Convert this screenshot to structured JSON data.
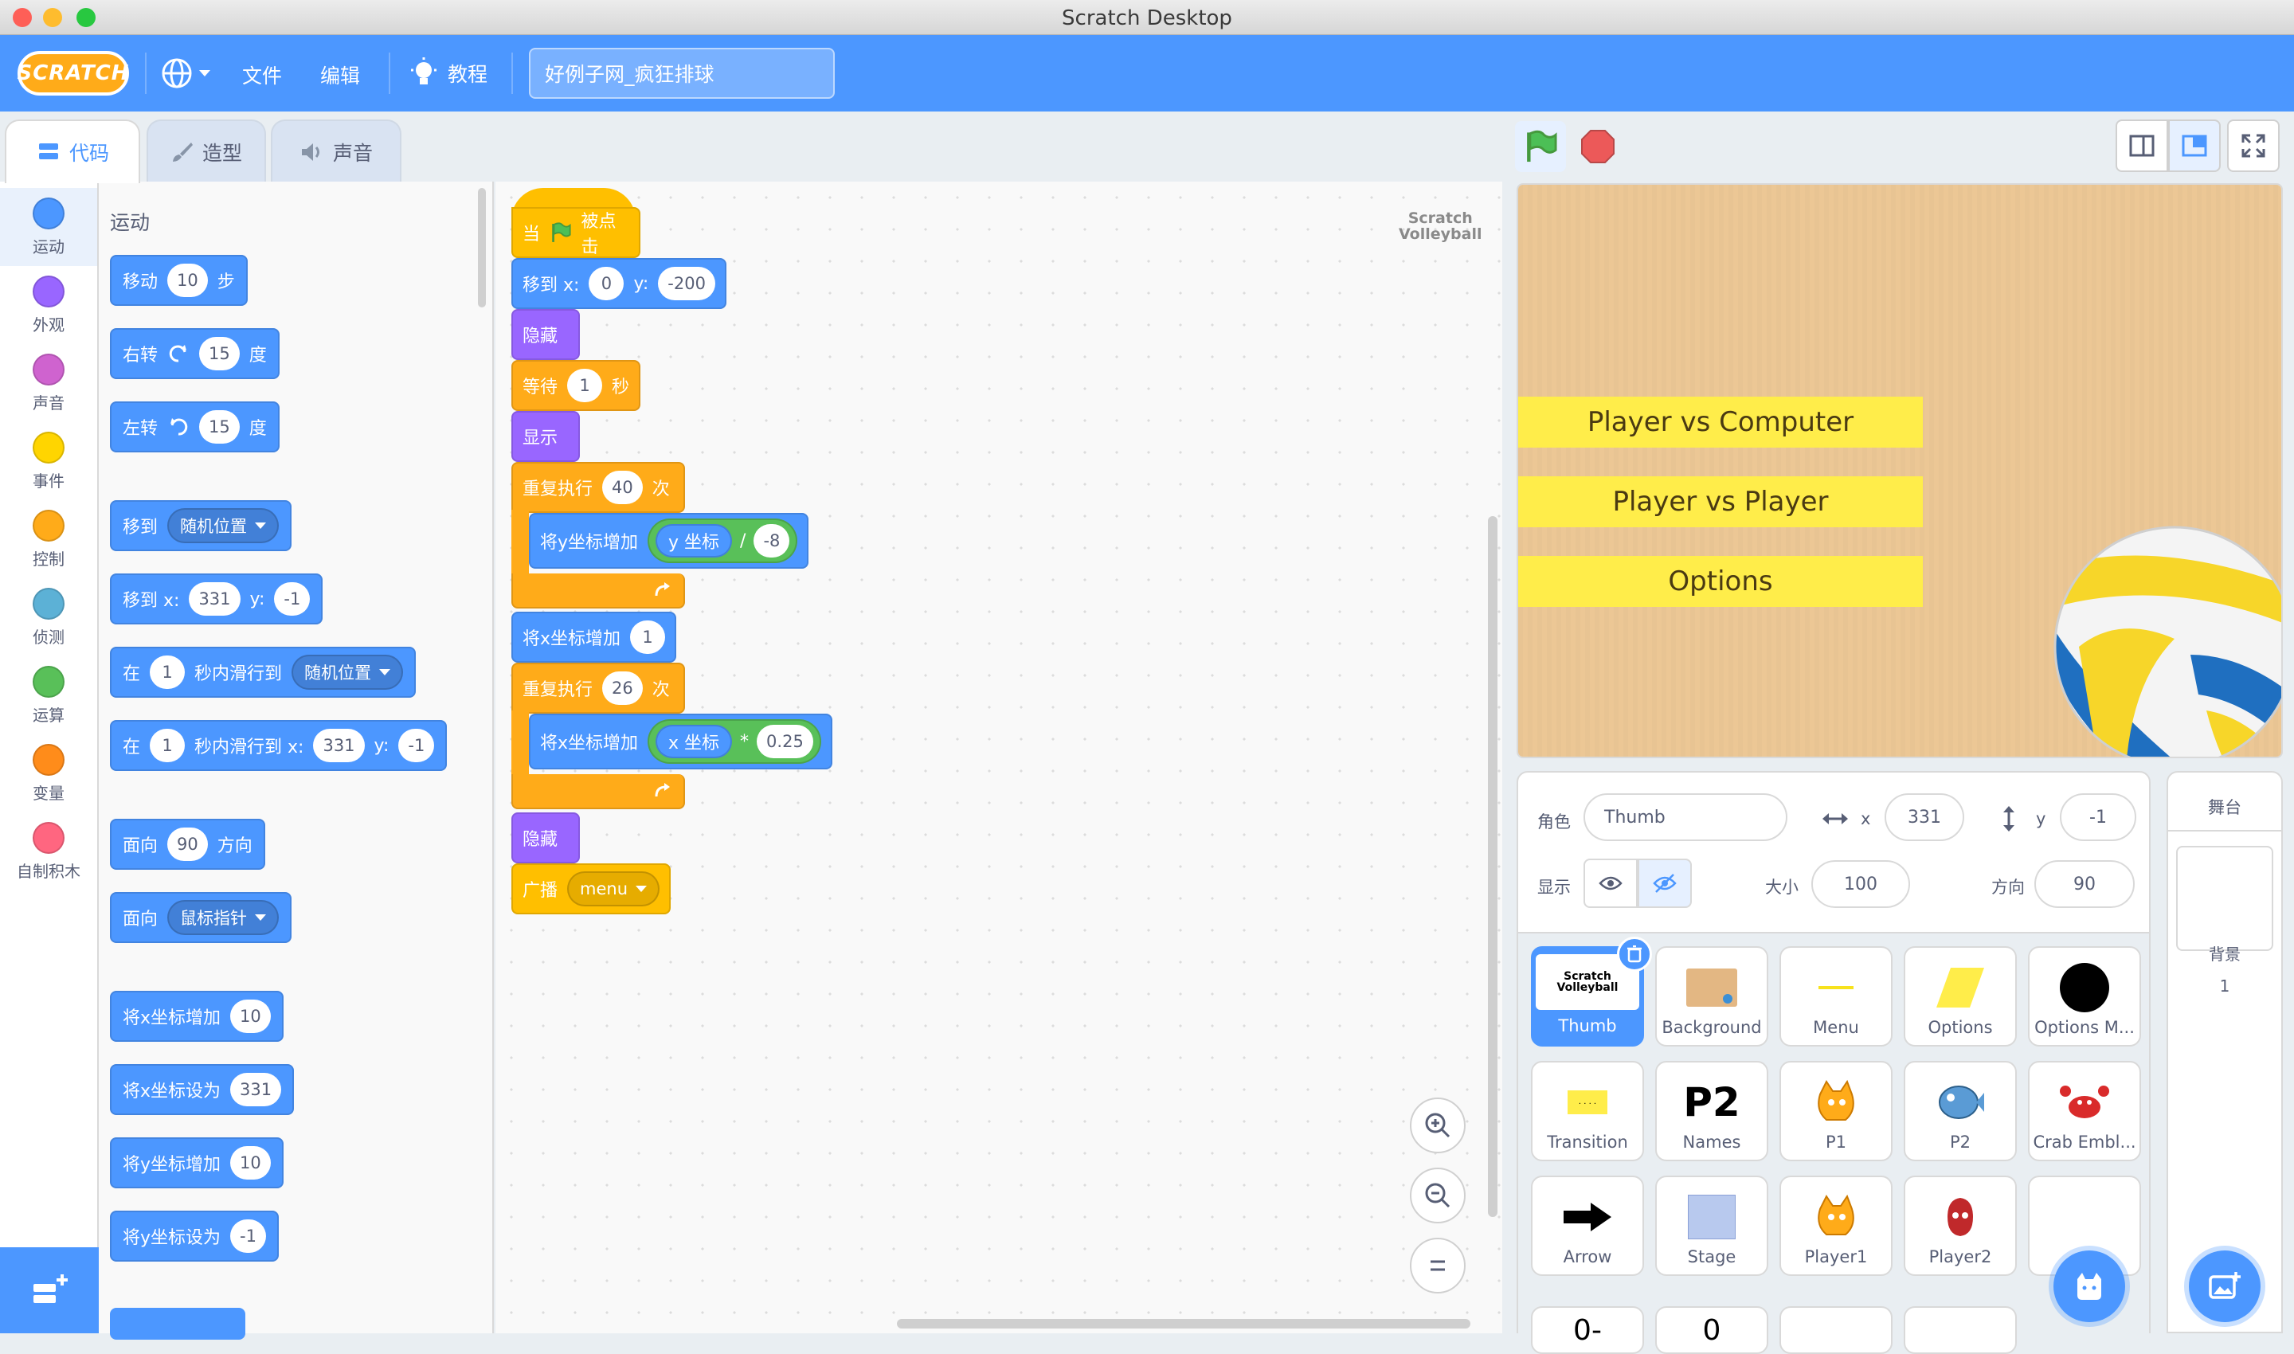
{
  "window": {
    "title": "Scratch Desktop"
  },
  "menubar": {
    "logo": "SCRATCH",
    "file": "文件",
    "edit": "编辑",
    "tutorials": "教程",
    "project_title": "好例子网_疯狂排球"
  },
  "tabs": {
    "code": "代码",
    "costumes": "造型",
    "sounds": "声音"
  },
  "categories": [
    {
      "label": "运动",
      "color": "#4c97ff"
    },
    {
      "label": "外观",
      "color": "#9966ff"
    },
    {
      "label": "声音",
      "color": "#cf63cf"
    },
    {
      "label": "事件",
      "color": "#ffd500"
    },
    {
      "label": "控制",
      "color": "#ffab19"
    },
    {
      "label": "侦测",
      "color": "#5cb1d6"
    },
    {
      "label": "运算",
      "color": "#59c059"
    },
    {
      "label": "变量",
      "color": "#ff8c1a"
    },
    {
      "label": "自制积木",
      "color": "#ff6680"
    }
  ],
  "palette": {
    "heading": "运动",
    "move": {
      "label": "移动",
      "value": "10",
      "unit": "步"
    },
    "turn_right": {
      "label": "右转",
      "value": "15",
      "unit": "度"
    },
    "turn_left": {
      "label": "左转",
      "value": "15",
      "unit": "度"
    },
    "goto": {
      "label": "移到",
      "target": "随机位置"
    },
    "goto_xy": {
      "label": "移到 x:",
      "x": "331",
      "ylabel": "y:",
      "y": "-1"
    },
    "glide_to": {
      "label1": "在",
      "secs": "1",
      "label2": "秒内滑行到",
      "target": "随机位置"
    },
    "glide_xy": {
      "label1": "在",
      "secs": "1",
      "label2": "秒内滑行到 x:",
      "x": "331",
      "ylabel": "y:",
      "y": "-1"
    },
    "point_dir": {
      "label": "面向",
      "value": "90",
      "unit": "方向"
    },
    "point_towards": {
      "label": "面向",
      "target": "鼠标指针"
    },
    "change_x": {
      "label": "将x坐标增加",
      "value": "10"
    },
    "set_x": {
      "label": "将x坐标设为",
      "value": "331"
    },
    "change_y": {
      "label": "将y坐标增加",
      "value": "10"
    },
    "set_y": {
      "label": "将y坐标设为",
      "value": "-1"
    }
  },
  "script": {
    "hat": {
      "when": "当",
      "clicked": "被点击"
    },
    "goto": {
      "label": "移到 x:",
      "x": "0",
      "ylabel": "y:",
      "y": "-200"
    },
    "hide1": "隐藏",
    "wait": {
      "label": "等待",
      "value": "1",
      "unit": "秒"
    },
    "show": "显示",
    "repeat1": {
      "label": "重复执行",
      "value": "40",
      "unit": "次"
    },
    "change_y": {
      "label": "将y坐标增加",
      "reporter": "y 坐标",
      "op": "/",
      "value": "-8"
    },
    "change_x1": {
      "label": "将x坐标增加",
      "value": "1"
    },
    "repeat2": {
      "label": "重复执行",
      "value": "26",
      "unit": "次"
    },
    "change_x2": {
      "label": "将x坐标增加",
      "reporter": "x 坐标",
      "op": "*",
      "value": "0.25"
    },
    "hide2": "隐藏",
    "broadcast": {
      "label": "广播",
      "value": "menu"
    }
  },
  "workspace_thumb": {
    "line1": "Scratch",
    "line2": "Volleyball"
  },
  "stage": {
    "buttons": [
      "Player vs Computer",
      "Player vs Player",
      "Options"
    ],
    "bg_color": "#ecc795"
  },
  "sprite_info": {
    "sprite_label": "角色",
    "sprite_name": "Thumb",
    "x_label": "x",
    "x": "331",
    "y_label": "y",
    "y": "-1",
    "show_label": "显示",
    "size_label": "大小",
    "size": "100",
    "direction_label": "方向",
    "direction": "90"
  },
  "sprites": [
    {
      "name": "Thumb",
      "icon": "thumb-icon"
    },
    {
      "name": "Background",
      "icon": "background-icon"
    },
    {
      "name": "Menu",
      "icon": "menu-icon"
    },
    {
      "name": "Options",
      "icon": "options-icon"
    },
    {
      "name": "Options M...",
      "icon": "black-circle-icon"
    },
    {
      "name": "Transition",
      "icon": "transition-icon"
    },
    {
      "name": "Names",
      "icon": "p2-text-icon"
    },
    {
      "name": "P1",
      "icon": "cat-icon"
    },
    {
      "name": "P2",
      "icon": "fish-icon"
    },
    {
      "name": "Crab Embl...",
      "icon": "crab-icon"
    },
    {
      "name": "Arrow",
      "icon": "arrow-icon"
    },
    {
      "name": "Stage",
      "icon": "stage-icon"
    },
    {
      "name": "Player1",
      "icon": "cat-icon"
    },
    {
      "name": "Player2",
      "icon": "player2-icon"
    },
    {
      "name": "",
      "icon": "white-circle-icon"
    }
  ],
  "sprites_row4": {
    "a": "0-",
    "b": "0"
  },
  "stage_panel": {
    "title": "舞台",
    "backdrop_label": "背景",
    "backdrop_count": "1"
  }
}
